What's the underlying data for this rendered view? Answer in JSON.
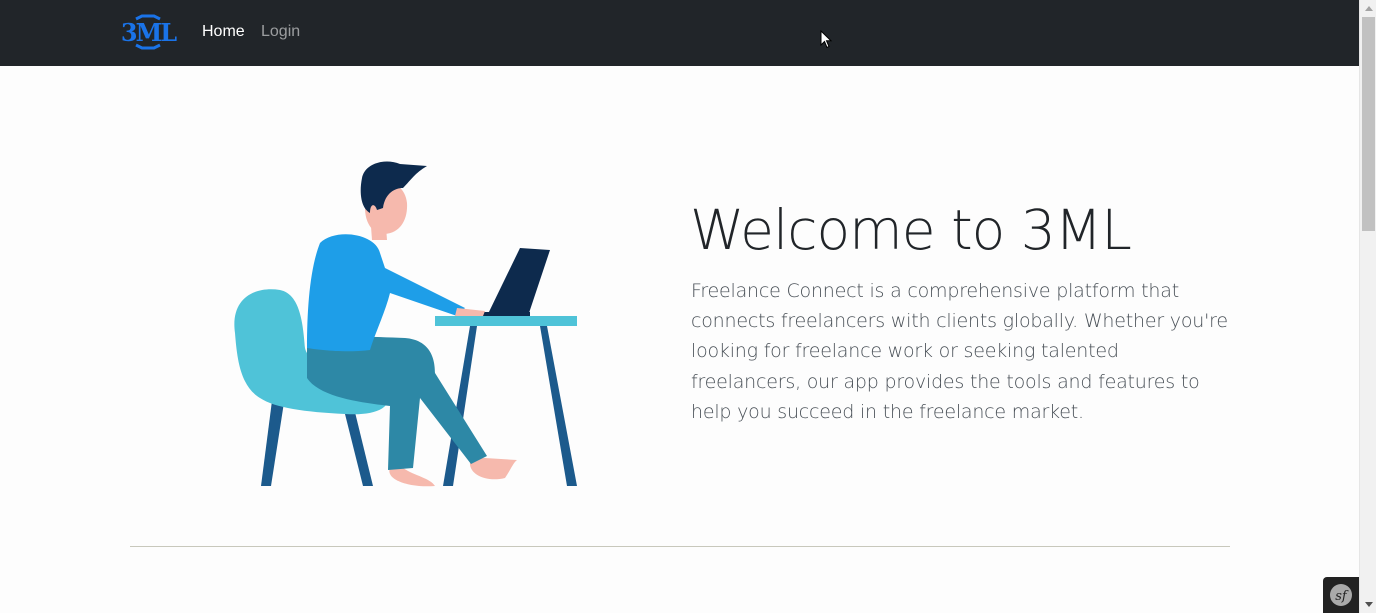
{
  "navbar": {
    "brand_text": "3ML",
    "links": [
      {
        "label": "Home",
        "active": true
      },
      {
        "label": "Login",
        "active": false
      }
    ]
  },
  "hero": {
    "title": "Welcome to 3ML",
    "description": "Freelance Connect is a comprehensive platform that connects freelancers with clients globally. Whether you're looking for freelance work or seeking talented freelancers, our app provides the tools and features to help you succeed in the freelance market."
  },
  "colors": {
    "navbar_bg": "#212529",
    "brand_blue": "#1a73e8",
    "chair": "#4fc3d8",
    "shirt": "#1e9ee8",
    "pants": "#2d88a6",
    "desk_legs": "#1c5a8c",
    "hair": "#0d2a4d",
    "skin": "#f6b9ad"
  },
  "icons": {
    "cursor": "mouse-pointer-icon",
    "scroll_up": "scroll-up-arrow-icon",
    "scroll_down": "scroll-down-arrow-icon",
    "symfony": "symfony-toolbar-icon"
  }
}
